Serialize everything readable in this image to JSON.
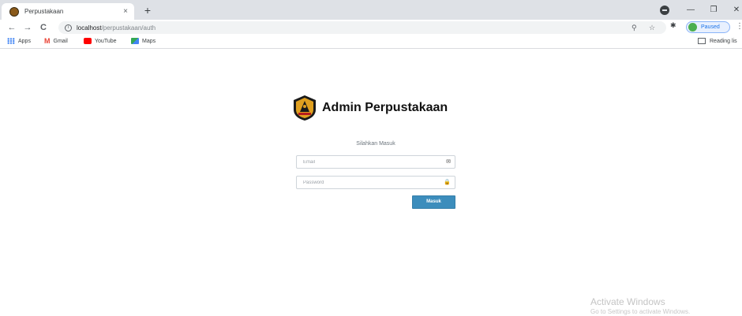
{
  "tab": {
    "title": "Perpustakaan",
    "close": "×",
    "new": "+"
  },
  "window_controls": {
    "minimize": "—",
    "restore": "❐",
    "close": "✕"
  },
  "toolbar": {
    "back": "←",
    "forward": "→",
    "reload": "C",
    "url_host": "localhost",
    "url_path": "/perpustakaan/auth",
    "profile_status": "Paused"
  },
  "bookmarks": {
    "items": [
      {
        "label": "Apps",
        "icon": "apps-icon"
      },
      {
        "label": "Gmail",
        "icon": "gmail-icon"
      },
      {
        "label": "YouTube",
        "icon": "youtube-icon"
      },
      {
        "label": "Maps",
        "icon": "maps-icon"
      }
    ],
    "reading_list": "Reading lis"
  },
  "page": {
    "title": "Admin Perpustakaan",
    "subtitle": "Silahkan Masuk",
    "email_placeholder": "Email",
    "password_placeholder": "Password",
    "submit_label": "Masuk",
    "accent_color": "#3c8dbc"
  },
  "watermark": {
    "title": "Activate Windows",
    "subtitle": "Go to Settings to activate Windows."
  }
}
